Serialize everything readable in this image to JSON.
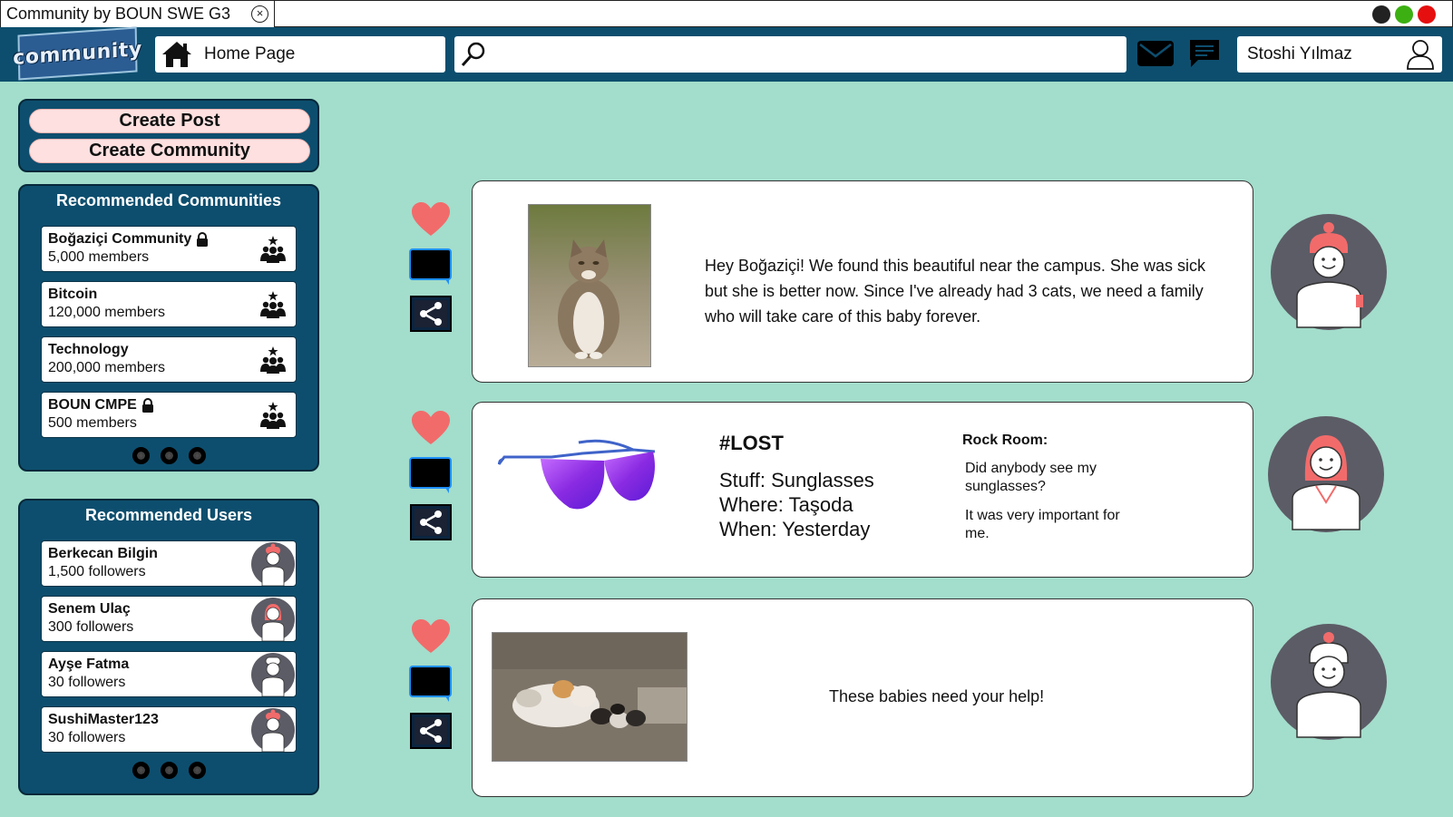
{
  "window": {
    "tab_title": "Community by BOUN SWE G3",
    "tab_close_glyph": "×",
    "controls": [
      {
        "name": "minimize",
        "color": "#222222"
      },
      {
        "name": "maximize",
        "color": "#3cb012"
      },
      {
        "name": "close",
        "color": "#e60f0f"
      }
    ]
  },
  "header": {
    "logo_text": "community",
    "home_label": "Home Page",
    "home_icon": "home-icon",
    "search_icon": "search-icon",
    "search_placeholder": "",
    "mail_icon": "mail-icon",
    "chat_icon": "chat-icon",
    "user_name": "Stoshi Yılmaz",
    "user_icon": "user-icon"
  },
  "actions": {
    "create_post": "Create Post",
    "create_community": "Create Community"
  },
  "communities": {
    "title": "Recommended Communities",
    "items": [
      {
        "name": "Boğaziçi Community",
        "members": "5,000 members",
        "locked": true
      },
      {
        "name": "Bitcoin",
        "members": "120,000 members",
        "locked": false
      },
      {
        "name": "Technology",
        "members": "200,000 members",
        "locked": false
      },
      {
        "name": "BOUN CMPE",
        "members": "500 members",
        "locked": true
      }
    ]
  },
  "users": {
    "title": "Recommended Users",
    "items": [
      {
        "name": "Berkecan Bilgin",
        "followers": "1,500 followers"
      },
      {
        "name": "Senem Ulaç",
        "followers": "300 followers"
      },
      {
        "name": "Ayşe Fatma",
        "followers": "30 followers"
      },
      {
        "name": "SushiMaster123",
        "followers": "30 followers"
      }
    ]
  },
  "posts": [
    {
      "text": "Hey Boğaziçi! We found this beautiful near the campus. She was sick but she is better now. Since I've already had 3 cats, we need a family who will take care of this baby forever."
    },
    {
      "title": "#LOST",
      "lines": [
        "Stuff: Sunglasses",
        "Where: Taşoda",
        "When: Yesterday"
      ],
      "room_label": "Rock Room:",
      "room_messages": [
        "Did anybody see my sunglasses?",
        "It was very important for me."
      ]
    },
    {
      "text": "These babies need your help!"
    }
  ],
  "colors": {
    "header_bg": "#0d4e6e",
    "main_bg": "#a3ddcb",
    "heart": "#f26b6b",
    "pill_bg": "#fde0df",
    "avatar_bg": "#5c5c66"
  }
}
